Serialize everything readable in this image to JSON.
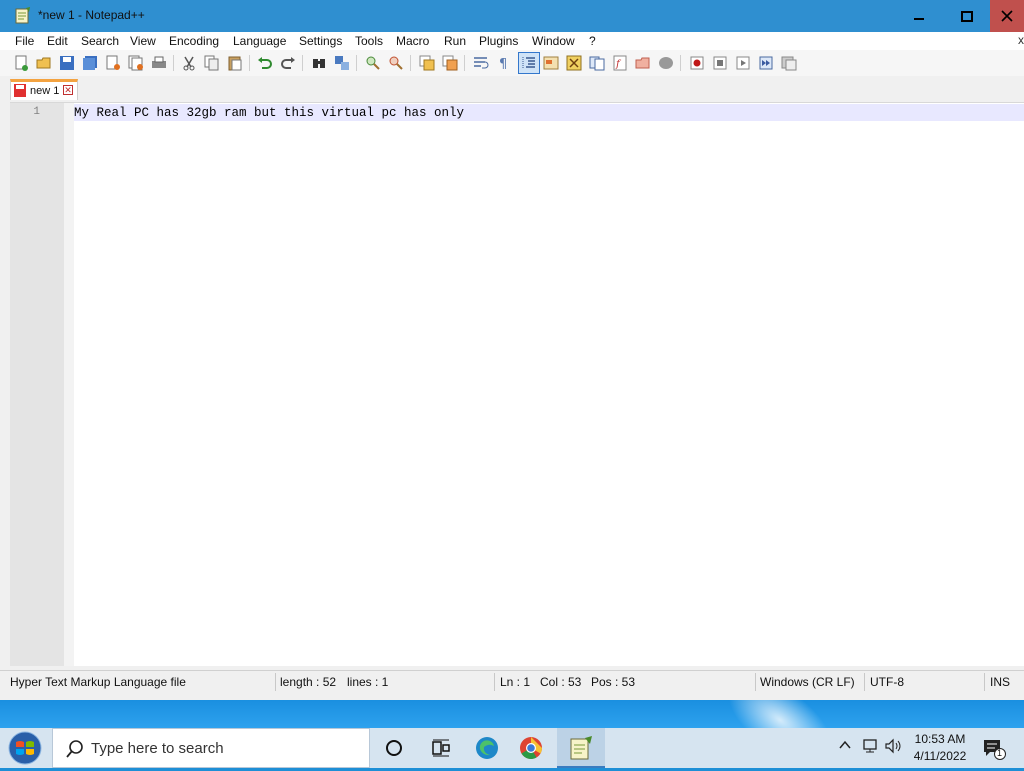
{
  "window": {
    "title": "*new 1 - Notepad++"
  },
  "menu": {
    "items": [
      "File",
      "Edit",
      "Search",
      "View",
      "Encoding",
      "Language",
      "Settings",
      "Tools",
      "Macro",
      "Run",
      "Plugins",
      "Window",
      "?"
    ],
    "close_glyph": "x"
  },
  "tabs": [
    {
      "label": "new 1",
      "modified": true
    }
  ],
  "editor": {
    "line_numbers": [
      "1"
    ],
    "lines": [
      "My Real PC has 32gb ram but this virtual pc has only"
    ]
  },
  "status": {
    "language": "Hyper Text Markup Language file",
    "length": "length : 52",
    "lines": "lines : 1",
    "ln": "Ln : 1",
    "col": "Col : 53",
    "pos": "Pos : 53",
    "eol": "Windows (CR LF)",
    "encoding": "UTF-8",
    "mode": "INS"
  },
  "taskbar": {
    "search_placeholder": "Type here to search",
    "time": "10:53 AM",
    "date": "4/11/2022",
    "notification_count": "1"
  },
  "colors": {
    "titlebar": "#2f8fd0",
    "close_button": "#c0504d",
    "tab_accent": "#f4a340",
    "current_line": "#e8e8ff"
  }
}
